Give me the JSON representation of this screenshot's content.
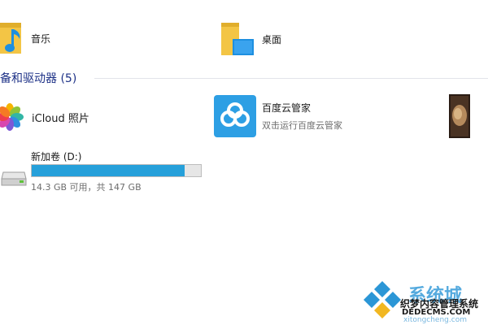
{
  "folders": [
    {
      "name": "音乐",
      "icon": "music-folder-icon"
    },
    {
      "name": "桌面",
      "icon": "desktop-folder-icon"
    }
  ],
  "section": {
    "title": "备和驱动器 (5)"
  },
  "devices": [
    {
      "name": "iCloud 照片",
      "icon": "icloud-photos-icon"
    },
    {
      "name": "百度云管家",
      "subtitle": "双击运行百度云管家",
      "icon": "baidu-cloud-icon"
    },
    {
      "name": "",
      "icon": "media-thumbnail-icon"
    }
  ],
  "drive": {
    "name": "新加卷 (D:)",
    "free_text": "14.3 GB 可用，共 147 GB",
    "used_fraction": 0.903,
    "icon": "hard-drive-icon",
    "bar_color": "#26a0da"
  },
  "watermark": {
    "brand": "系统城",
    "cms": "织梦内容管理系统",
    "site": "DEDECMS.COM",
    "domain": "xitongcheng.com"
  },
  "colors": {
    "section_title": "#1e3287",
    "folder_yellow": "#f3c545",
    "accent_blue": "#26a0da"
  }
}
